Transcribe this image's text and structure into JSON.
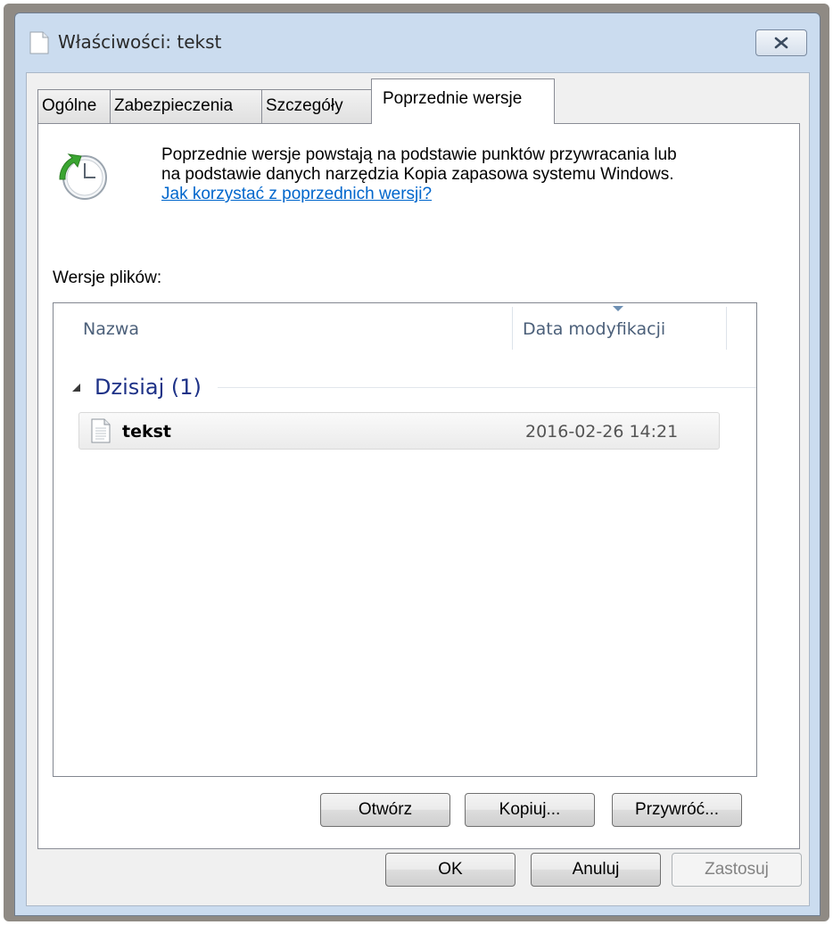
{
  "window": {
    "title": "Właściwości: tekst",
    "close_icon": "close-icon"
  },
  "tabs": [
    {
      "label": "Ogólne",
      "active": false
    },
    {
      "label": "Zabezpieczenia",
      "active": false
    },
    {
      "label": "Szczegóły",
      "active": false
    },
    {
      "label": "Poprzednie wersje",
      "active": true
    }
  ],
  "info": {
    "icon": "restore-clock-icon",
    "line1": "Poprzednie wersje powstają na podstawie punktów przywracania lub",
    "line2": "na podstawie danych narzędzia Kopia zapasowa systemu Windows.",
    "link": "Jak korzystać z poprzednich wersji?"
  },
  "versions": {
    "label": "Wersje plików:",
    "columns": [
      "Nazwa",
      "Data modyfikacji"
    ],
    "group": {
      "title": "Dzisiaj (1)"
    },
    "rows": [
      {
        "name": "tekst",
        "date": "2016-02-26 14:21",
        "icon": "text-file-icon"
      }
    ]
  },
  "panel_buttons": {
    "open": "Otwórz",
    "copy": "Kopiuj...",
    "restore": "Przywróć..."
  },
  "dialog_buttons": {
    "ok": "OK",
    "cancel": "Anuluj",
    "apply": "Zastosuj"
  },
  "colors": {
    "link": "#0066cc",
    "group_title": "#1e3287",
    "frame": "#cbdcef"
  }
}
